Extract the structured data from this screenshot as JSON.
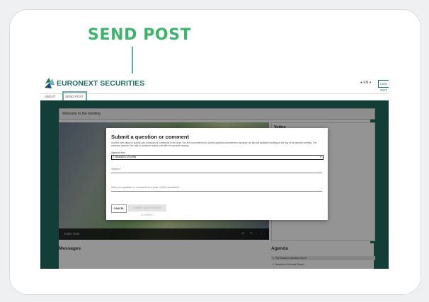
{
  "callout": {
    "title": "SEND POST"
  },
  "app": {
    "brand": "EURONEXT SECURITIES",
    "language": "EN",
    "logout_label": "LOG OUT"
  },
  "nav": {
    "items": [
      {
        "label": "ABOUT"
      },
      {
        "label": "SEND POST"
      }
    ]
  },
  "page": {
    "welcome_text": "Welcome to the meeting",
    "voting_title": "Voting",
    "video_time": "0:00 / 0:00",
    "messages_title": "Messages",
    "agenda_title": "Agenda",
    "agenda_items": [
      "1. The board of directors report",
      "2. Adoption of Annual Report"
    ]
  },
  "modal": {
    "title": "Submit a question or comment",
    "description": "Use the form below to submit your questions or comments to the chair. You are recommended to submit questions/comments in advance, as this will facilitate handling on the day of the general meeting. The company reserves the right to postpone replies until after the general meeting.",
    "agenda_label": "Agenda item",
    "agenda_value": "2. Allocation of profits",
    "subject_placeholder": "Subject *",
    "message_placeholder": "Write your question or comment here (max. 4,000 characters) *",
    "cancel_label": "CANCEL",
    "submit_label": "SUBMIT QUESTION OR COMMENT"
  },
  "colors": {
    "accent": "#3db36b",
    "brand": "#1f6b60"
  }
}
